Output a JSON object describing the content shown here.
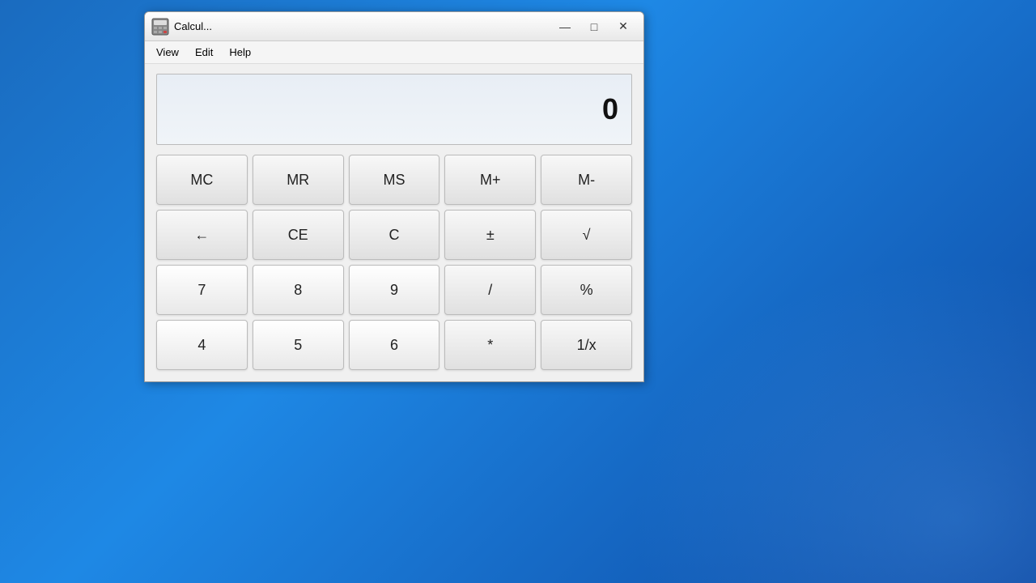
{
  "window": {
    "title": "Calcul...",
    "icon_alt": "calculator-icon"
  },
  "title_controls": {
    "minimize": "—",
    "maximize": "□",
    "close": "✕"
  },
  "menu": {
    "items": [
      "View",
      "Edit",
      "Help"
    ]
  },
  "display": {
    "value": "0"
  },
  "buttons": {
    "row1": [
      {
        "label": "MC",
        "name": "mc-button"
      },
      {
        "label": "MR",
        "name": "mr-button"
      },
      {
        "label": "MS",
        "name": "ms-button"
      },
      {
        "label": "M+",
        "name": "mplus-button"
      },
      {
        "label": "M-",
        "name": "mminus-button"
      }
    ],
    "row2": [
      {
        "label": "←",
        "name": "backspace-button"
      },
      {
        "label": "CE",
        "name": "ce-button"
      },
      {
        "label": "C",
        "name": "c-button"
      },
      {
        "label": "±",
        "name": "plusminus-button"
      },
      {
        "label": "√",
        "name": "sqrt-button"
      }
    ],
    "row3": [
      {
        "label": "7",
        "name": "seven-button"
      },
      {
        "label": "8",
        "name": "eight-button"
      },
      {
        "label": "9",
        "name": "nine-button"
      },
      {
        "label": "/",
        "name": "divide-button"
      },
      {
        "label": "%",
        "name": "percent-button"
      }
    ],
    "row4": [
      {
        "label": "4",
        "name": "four-button"
      },
      {
        "label": "5",
        "name": "five-button"
      },
      {
        "label": "6",
        "name": "six-button"
      },
      {
        "label": "*",
        "name": "multiply-button"
      },
      {
        "label": "1/x",
        "name": "reciprocal-button"
      }
    ]
  }
}
